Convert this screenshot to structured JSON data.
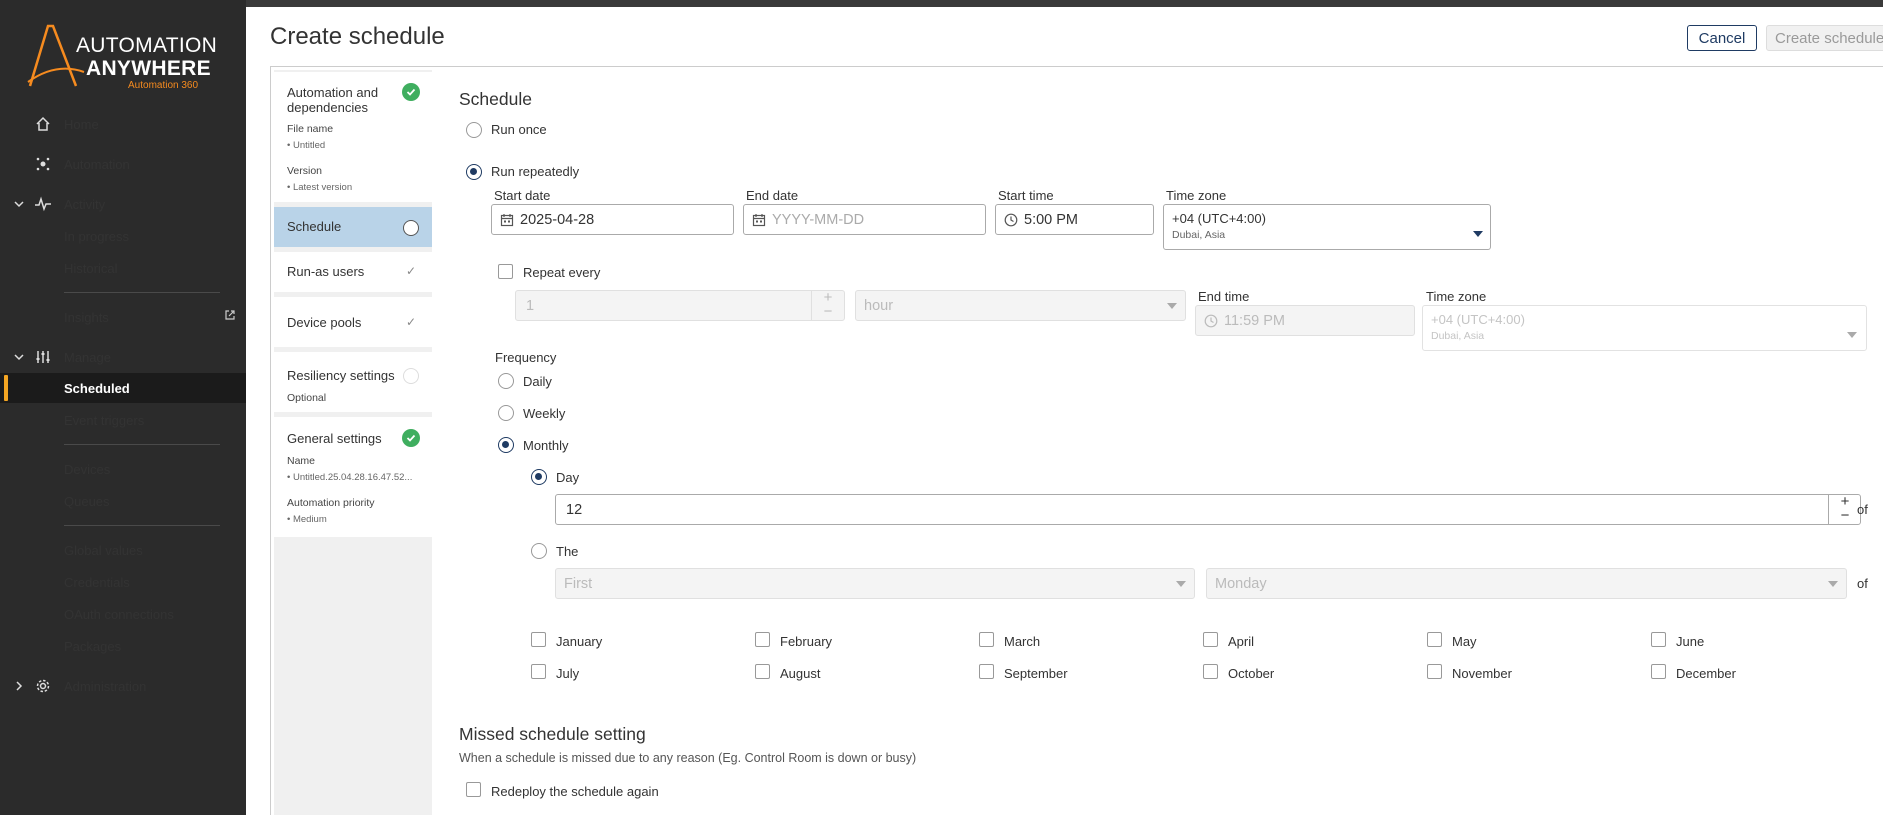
{
  "app": {
    "logo_line1": "AUTOMATION",
    "logo_line2": "ANYWHERE",
    "logo_line3": "Automation 360",
    "brand_color": "#f68b1f",
    "accent_color": "#1f3b63"
  },
  "sidebar": {
    "home": "Home",
    "automation": "Automation",
    "activity": "Activity",
    "in_progress": "In progress",
    "historical": "Historical",
    "insights": "Insights",
    "manage": "Manage",
    "scheduled": "Scheduled",
    "event_triggers": "Event triggers",
    "devices": "Devices",
    "queues": "Queues",
    "global_values": "Global values",
    "credentials": "Credentials",
    "oauth": "OAuth connections",
    "packages": "Packages",
    "administration": "Administration"
  },
  "header": {
    "title": "Create schedule",
    "cancel": "Cancel",
    "create": "Create schedule"
  },
  "steps": {
    "automation_title": "Automation and dependencies",
    "file_name_label": "File name",
    "file_name_value": "• Untitled",
    "version_label": "Version",
    "version_value": "• Latest version",
    "schedule": "Schedule",
    "run_as": "Run-as users",
    "device_pools": "Device pools",
    "resiliency": "Resiliency settings",
    "resiliency_sub": "Optional",
    "general": "General settings",
    "name_label": "Name",
    "name_value": "• Untitled.25.04.28.16.47.52...",
    "priority_label": "Automation priority",
    "priority_value": "• Medium"
  },
  "form": {
    "section_title": "Schedule",
    "run_once": "Run once",
    "run_repeatedly": "Run repeatedly",
    "start_date_label": "Start date",
    "start_date_value": "2025-04-28",
    "end_date_label": "End date",
    "end_date_placeholder": "YYYY-MM-DD",
    "start_time_label": "Start time",
    "start_time_value": "5:00 PM",
    "timezone_label": "Time zone",
    "timezone_value": "+04 (UTC+4:00)",
    "timezone_city": "Dubai, Asia",
    "repeat_every": "Repeat every",
    "repeat_value": "1",
    "repeat_unit": "hour",
    "end_time_label": "End time",
    "end_time_value": "11:59 PM",
    "timezone2_label": "Time zone",
    "timezone2_value": "+04 (UTC+4:00)",
    "timezone2_city": "Dubai, Asia",
    "frequency_label": "Frequency",
    "daily": "Daily",
    "weekly": "Weekly",
    "monthly": "Monthly",
    "day": "Day",
    "day_value": "12",
    "of": "of",
    "the": "The",
    "first": "First",
    "monday": "Monday",
    "months": [
      "January",
      "February",
      "March",
      "April",
      "May",
      "June",
      "July",
      "August",
      "September",
      "October",
      "November",
      "December"
    ]
  },
  "missed": {
    "title": "Missed schedule setting",
    "desc": "When a schedule is missed due to any reason (Eg. Control Room is down or busy)",
    "redeploy": "Redeploy the schedule again"
  }
}
